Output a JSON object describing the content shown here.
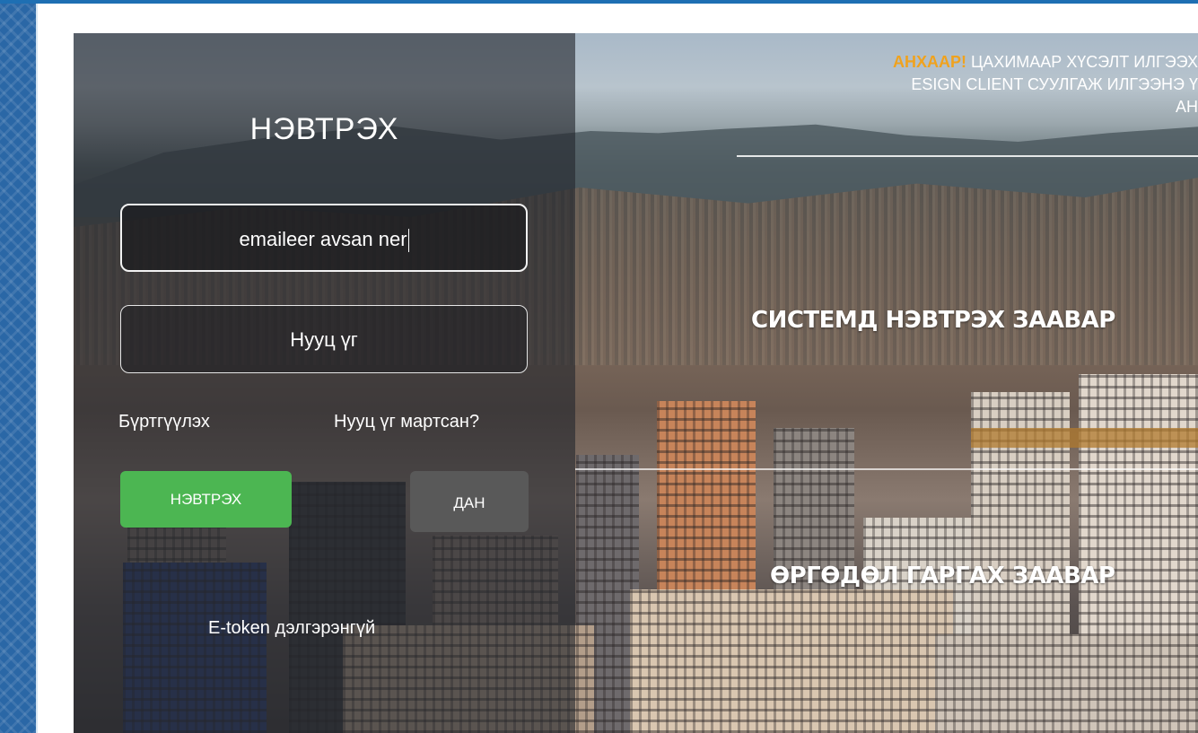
{
  "login": {
    "title": "НЭВТРЭХ",
    "username_value": "emaileer avsan ner",
    "password_placeholder": "Нууц үг",
    "register_link": "Бүртгүүлэх",
    "forgot_link": "Нууц үг мартсан?",
    "login_button": "НЭВТРЭХ",
    "dan_button": "ДАН",
    "etoken_link": "E-token дэлгэрэнгүй"
  },
  "notice": {
    "warning_label": "АНХААР!",
    "line1_rest": " ЦАХИМААР ХҮСЭЛТ ИЛГЭЭХ",
    "line2": "ESIGN CLIENT СУУЛГАЖ ИЛГЭЭНЭ Ү",
    "line3": "АН"
  },
  "sections": {
    "system_login_guide": "СИСТЕМД НЭВТРЭХ ЗААВАР",
    "application_guide": "ӨРГӨДӨЛ ГАРГАХ ЗААВАР"
  },
  "colors": {
    "login_button": "#4cb652",
    "dan_button": "#595959",
    "warning": "#f0a21d",
    "top_bar": "#1e6fb3"
  }
}
